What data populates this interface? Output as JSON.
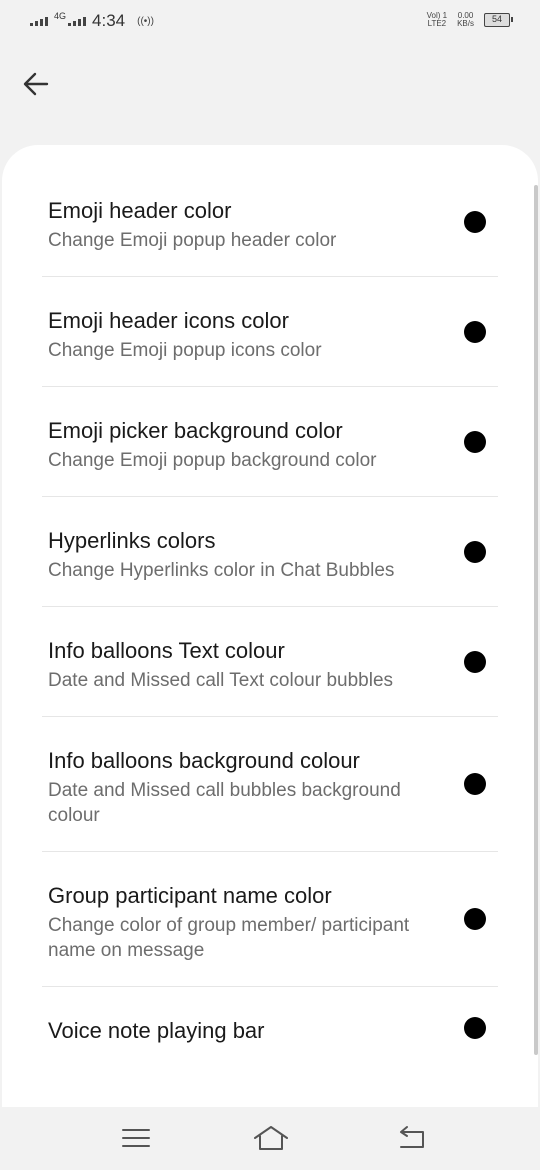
{
  "status_bar": {
    "network_type": "4G",
    "time": "4:34",
    "hotspot": "((•))",
    "volte_line1": "Vol) 1",
    "volte_line2": "LTE2",
    "speed_value": "0.00",
    "speed_unit": "KB/s",
    "battery": "54"
  },
  "settings_items": [
    {
      "title": "Emoji header color",
      "subtitle": "Change Emoji popup header color",
      "color": "#000000"
    },
    {
      "title": "Emoji header icons color",
      "subtitle": "Change Emoji popup icons color",
      "color": "#000000"
    },
    {
      "title": "Emoji picker background color",
      "subtitle": "Change Emoji popup background color",
      "color": "#000000"
    },
    {
      "title": "Hyperlinks colors",
      "subtitle": "Change Hyperlinks color in Chat Bubbles",
      "color": "#000000"
    },
    {
      "title": "Info balloons Text colour",
      "subtitle": "Date and Missed call Text colour bubbles",
      "color": "#000000"
    },
    {
      "title": "Info balloons background colour",
      "subtitle": "Date and Missed call bubbles background colour",
      "color": "#000000"
    },
    {
      "title": "Group participant name color",
      "subtitle": "Change color of group member/ participant name on message",
      "color": "#000000"
    },
    {
      "title": "Voice note playing bar",
      "subtitle": "",
      "color": "#000000"
    }
  ],
  "icons": {
    "back": "arrow-left-icon",
    "menu": "menu-icon",
    "home": "home-icon",
    "return": "return-icon"
  },
  "colors": {
    "background": "#f2f2f2",
    "card": "#ffffff",
    "color_dot": "#000000"
  }
}
